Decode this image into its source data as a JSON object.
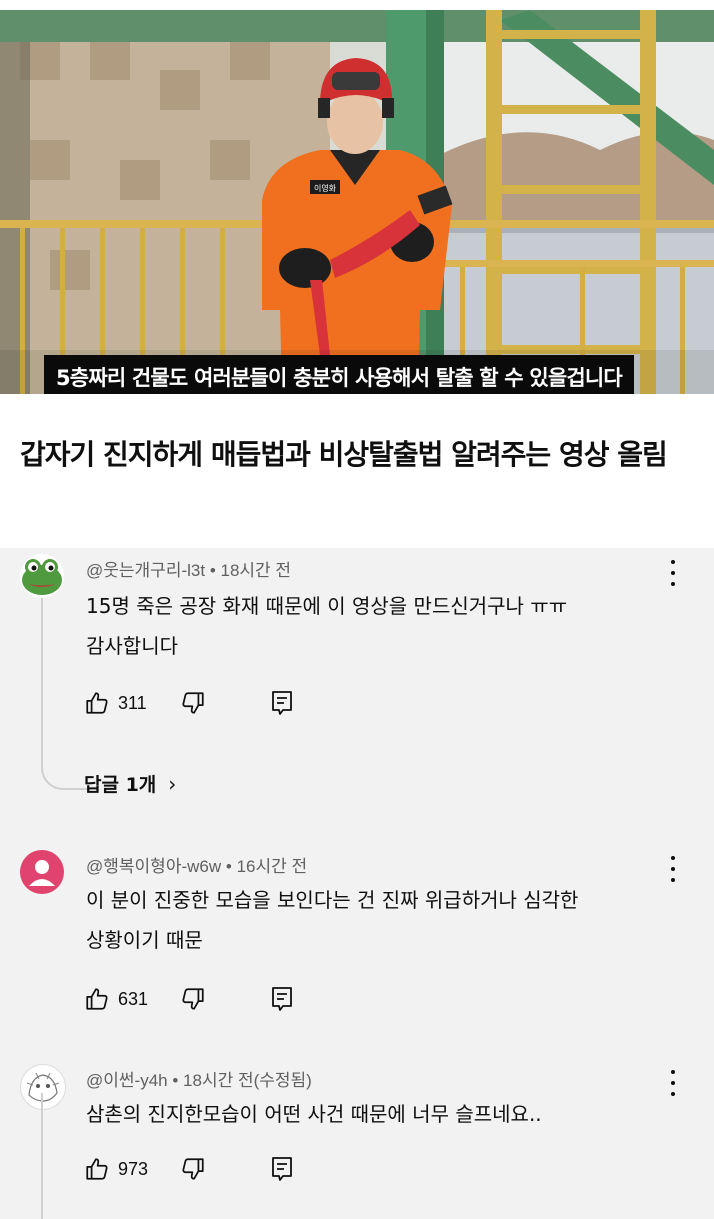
{
  "video": {
    "subtitle": "5층짜리 건물도 여러분들이 충분히 사용해서 탈출 할 수 있을겁니다",
    "name_tag": "이영화"
  },
  "title": "갑자기 진지하게 매듭법과 비상탈출법 알려주는 영상 올림",
  "comments": [
    {
      "handle": "@웃는개구리-l3t",
      "time": "18시간 전",
      "text_line1": "15명 죽은 공장 화재 때문에 이 영상을 만드신거구나 ㅠㅠ",
      "text_line2": "감사합니다",
      "likes": "311",
      "replies_label": "답글 1개",
      "avatar_icon": "frog-avatar"
    },
    {
      "handle": "@행복이형아-w6w",
      "time": "16시간 전",
      "text_line1": "이 분이 진중한 모습을 보인다는 건 진짜 위급하거나 심각한",
      "text_line2": "상황이기 때문",
      "likes": "631",
      "avatar_icon": "default-person-avatar"
    },
    {
      "handle": "@이썬-y4h",
      "time": "18시간 전(수정됨)",
      "text_line1": "삼촌의 진지한모습이 어떤 사건 때문에 너무 슬프네요..",
      "likes": "973",
      "avatar_icon": "sketch-avatar"
    }
  ],
  "colors": {
    "panel_bg": "#f2f2f2",
    "meta_text": "#606060",
    "avatar_pink": "#e0436e",
    "uniform_orange": "#f0701f"
  }
}
